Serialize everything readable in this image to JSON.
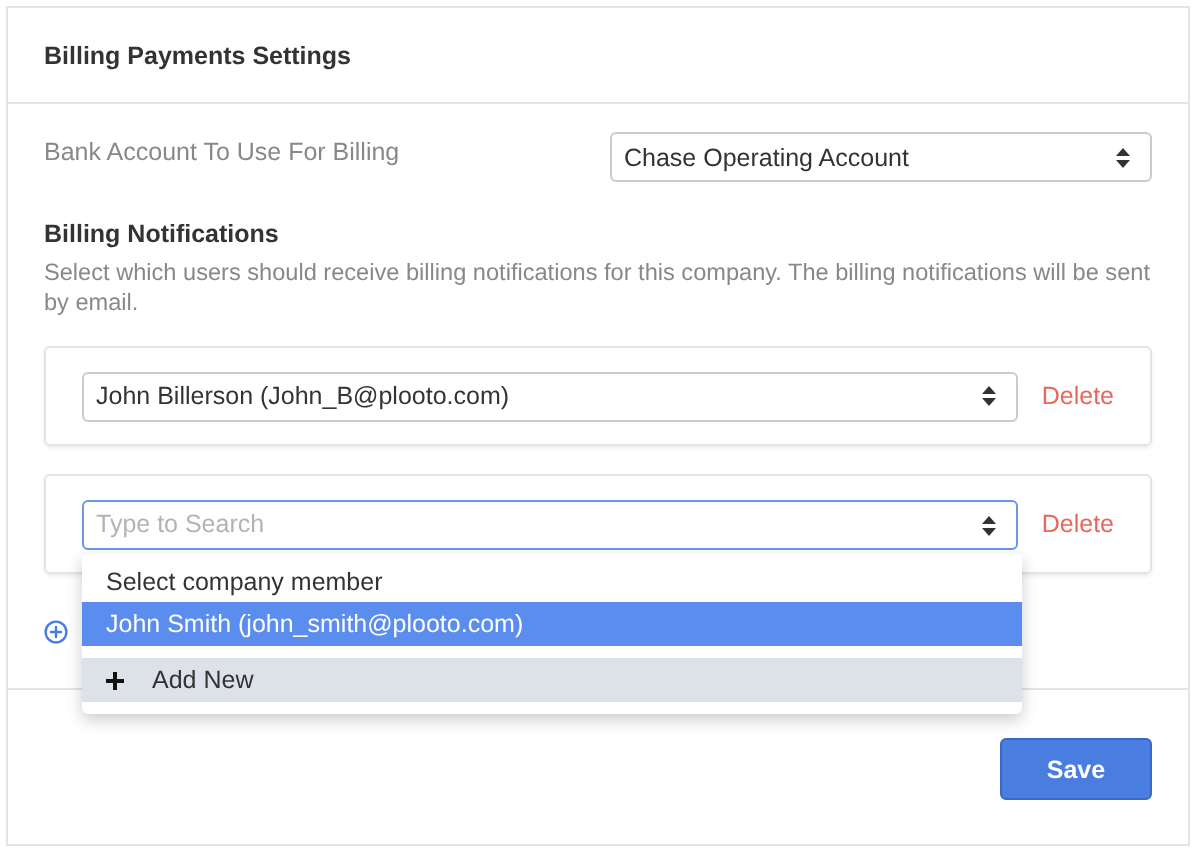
{
  "panel": {
    "title": "Billing Payments Settings"
  },
  "bank_account": {
    "label": "Bank Account To Use For Billing",
    "value": "Chase Operating Account"
  },
  "notifications": {
    "title": "Billing Notifications",
    "description": "Select which users should receive billing notifications for this company. The billing notifications will be sent by email.",
    "recipients": [
      {
        "kind": "select",
        "value": "John Billerson (John_B@plooto.com)",
        "delete": "Delete",
        "focused": false
      },
      {
        "kind": "search",
        "placeholder": "Type to Search",
        "delete": "Delete",
        "focused": true
      }
    ],
    "dropdown": {
      "header": "Select company member",
      "options": [
        {
          "label": "John Smith (john_smith@plooto.com)",
          "selected": true
        }
      ],
      "add_new": "Add New"
    }
  },
  "save_button": "Save"
}
